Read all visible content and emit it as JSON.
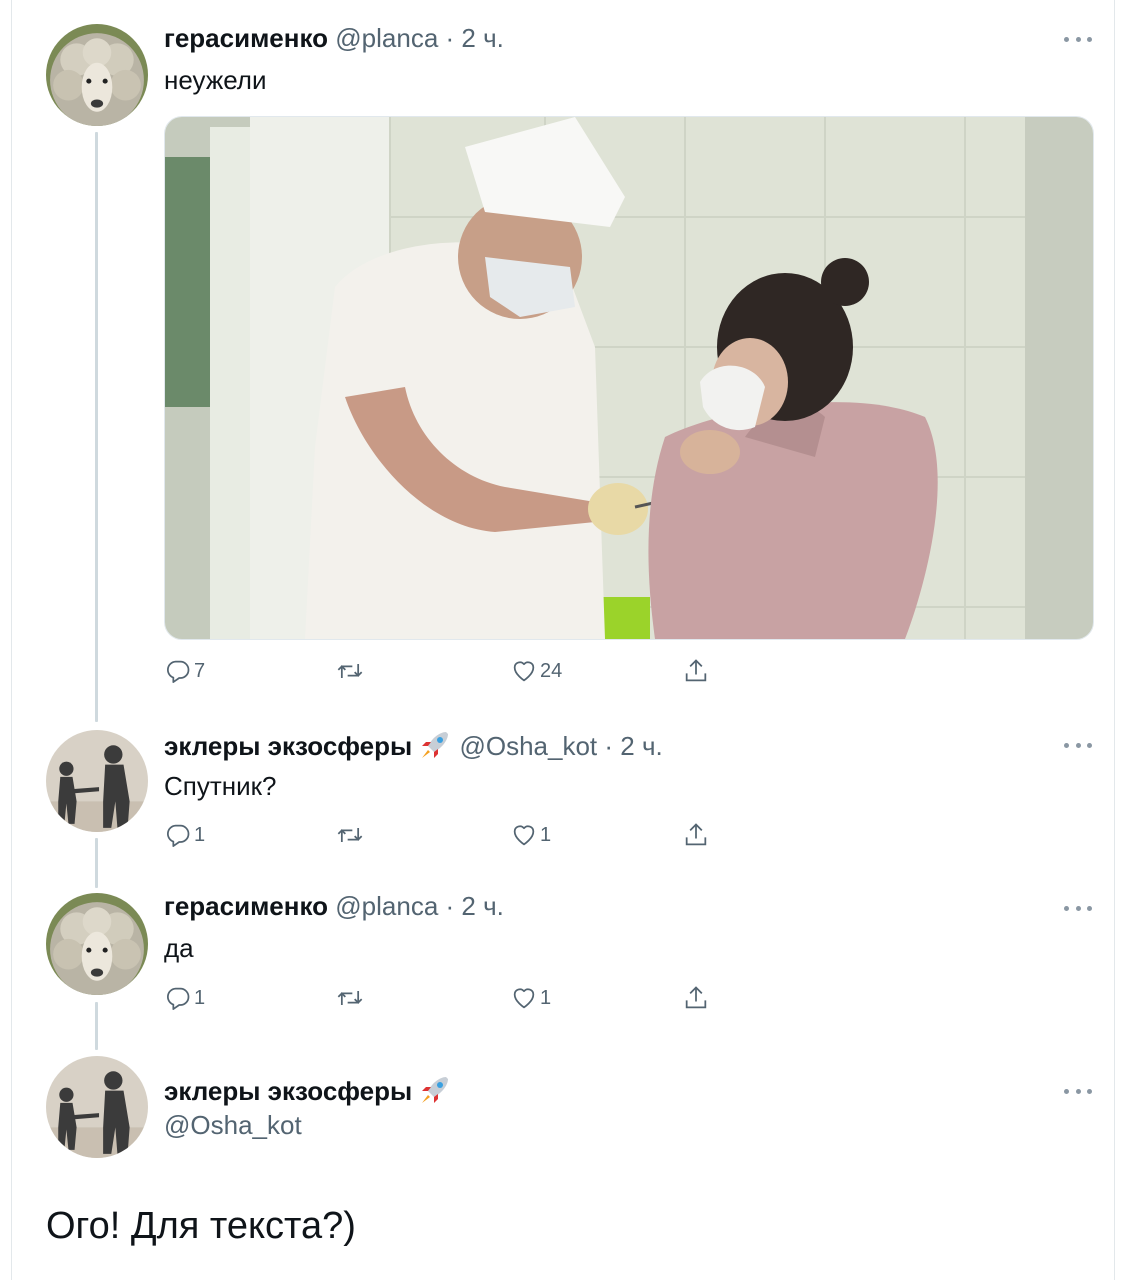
{
  "tweets": [
    {
      "name": "герасименко",
      "handle": "@planca",
      "separator": "·",
      "time": "2 ч.",
      "text": "неужели",
      "avatar": "sheep-avatar",
      "has_photo": true,
      "counts": {
        "replies": "7",
        "retweets": "",
        "likes": "24"
      }
    },
    {
      "name": "эклеры экзосферы",
      "emoji": "rocket-emoji",
      "handle": "@Osha_kot",
      "separator": "·",
      "time": "2 ч.",
      "text": "Спутник?",
      "avatar": "shadow-couple-avatar",
      "counts": {
        "replies": "1",
        "retweets": "",
        "likes": "1"
      }
    },
    {
      "name": "герасименко",
      "handle": "@planca",
      "separator": "·",
      "time": "2 ч.",
      "text": "да",
      "avatar": "sheep-avatar",
      "counts": {
        "replies": "1",
        "retweets": "",
        "likes": "1"
      }
    }
  ],
  "focused": {
    "name": "эклеры экзосферы",
    "emoji": "rocket-emoji",
    "handle": "@Osha_kot",
    "text": "Ого! Для текста?)",
    "avatar": "shadow-couple-avatar"
  },
  "colors": {
    "text_primary": "#0f1419",
    "text_secondary": "#536471",
    "thread_line": "#cfd9de",
    "icon_gray": "#536471"
  },
  "icons": {
    "reply": "reply-icon",
    "retweet": "retweet-icon",
    "like": "like-icon",
    "share": "share-icon",
    "more": "more-icon"
  }
}
